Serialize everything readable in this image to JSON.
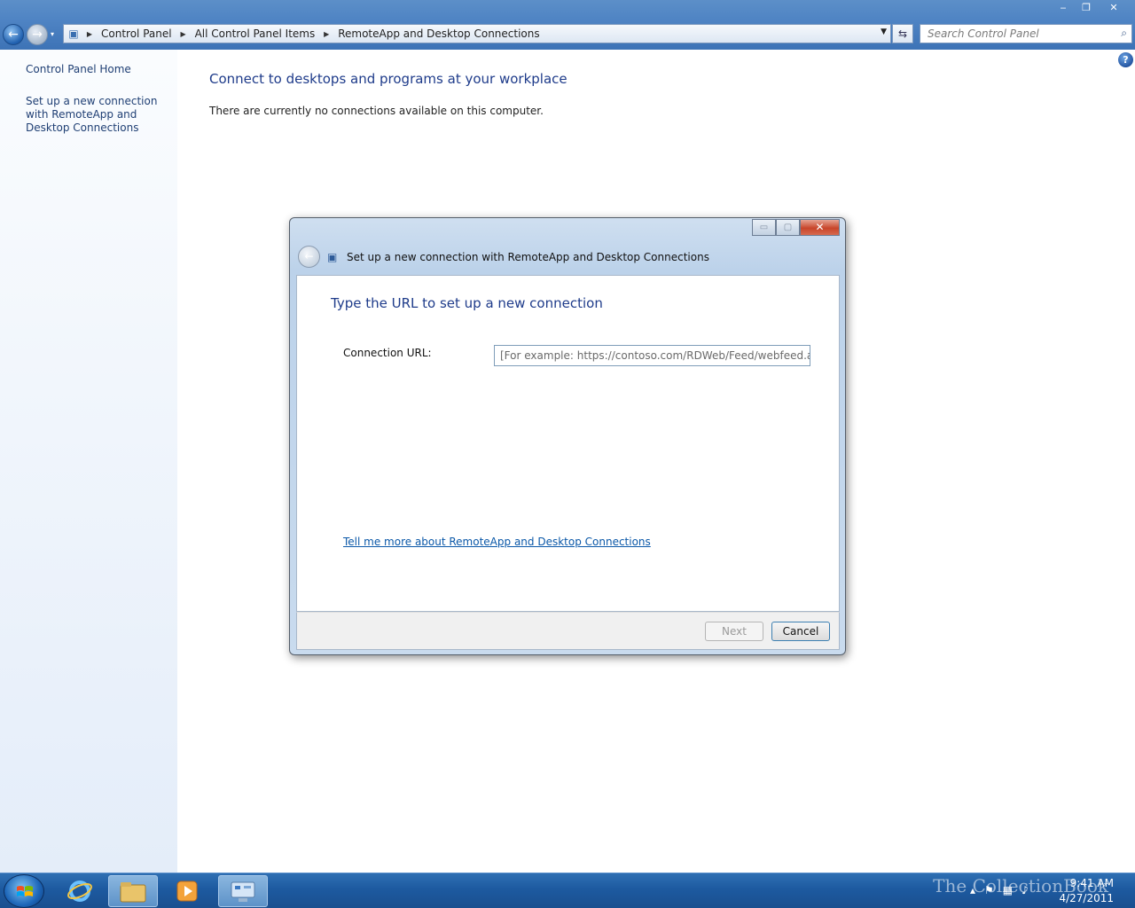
{
  "window": {
    "minimize_glyph": "‒",
    "restore_glyph": "❐",
    "close_glyph": "✕"
  },
  "navigation": {
    "back_glyph": "←",
    "forward_glyph": "→",
    "recent_glyph": "▾"
  },
  "address_bar": {
    "breadcrumbs": [
      "Control Panel",
      "All Control Panel Items",
      "RemoteApp and Desktop Connections"
    ],
    "separator_glyph": "▶",
    "dropdown_glyph": "▼",
    "refresh_glyph": "⇆"
  },
  "search": {
    "placeholder": "Search Control Panel",
    "icon_glyph": "⌕"
  },
  "sidebar": {
    "home_link": "Control Panel Home",
    "setup_link": "Set up a new connection with RemoteApp and Desktop Connections"
  },
  "main": {
    "title": "Connect to desktops and programs at your workplace",
    "status_text": "There are currently no connections available on this computer.",
    "help_glyph": "?"
  },
  "dialog": {
    "title": "Set up a new connection with RemoteApp and Desktop Connections",
    "heading": "Type the URL to set up a new connection",
    "url_label": "Connection URL:",
    "url_value": "",
    "url_placeholder": "[For example: https://contoso.com/RDWeb/Feed/webfeed.aspx]",
    "learn_more_link": "Tell me more about RemoteApp and Desktop Connections",
    "next_label": "Next",
    "cancel_label": "Cancel",
    "back_glyph": "←",
    "minimize_glyph": "▭",
    "restore_glyph": "▢",
    "close_glyph": "✕"
  },
  "taskbar": {
    "time": "9:41 AM",
    "date": "4/27/2011",
    "watermark": "The CollectionBook",
    "icons": [
      "internet-explorer-icon",
      "windows-explorer-icon",
      "media-player-icon",
      "control-panel-icon"
    ]
  },
  "colors": {
    "accent_blue": "#1e3b8a",
    "link_blue": "#0b58a8",
    "titlebar_blue": "#4f84c4",
    "close_red": "#c8452a"
  }
}
